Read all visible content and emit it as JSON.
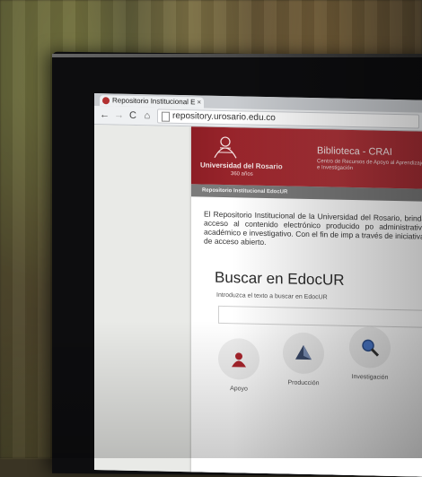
{
  "browser": {
    "tab_title": "Repositorio Institucional E",
    "tab_close": "×",
    "url": "repository.urosario.edu.co"
  },
  "banner": {
    "university_name": "Universidad del Rosario",
    "university_sub": "360 años",
    "crai_title": "Biblioteca - CRAI",
    "crai_subtitle": "Centro de Recursos de Apoyo al Aprendizaje e Investigación"
  },
  "crumb": "Repositorio Institucional EdocUR",
  "intro": "El Repositorio Institucional de la Universidad del Rosario, brindar acceso al contenido electrónico producido po administrativo, académico e investigativo. Con el fin de imp a través de iniciativas de acceso abierto.",
  "search": {
    "title": "Buscar en EdocUR",
    "hint": "Introduzca el texto a buscar en EdocUR",
    "value": ""
  },
  "cards": [
    {
      "label": "Apoyo",
      "icon": "seal-icon"
    },
    {
      "label": "Producción",
      "icon": "prism-icon"
    },
    {
      "label": "Investigación",
      "icon": "magnifier-icon"
    }
  ],
  "colors": {
    "banner_red": "#a52d34",
    "crumb_gray": "#7b7b7b"
  }
}
